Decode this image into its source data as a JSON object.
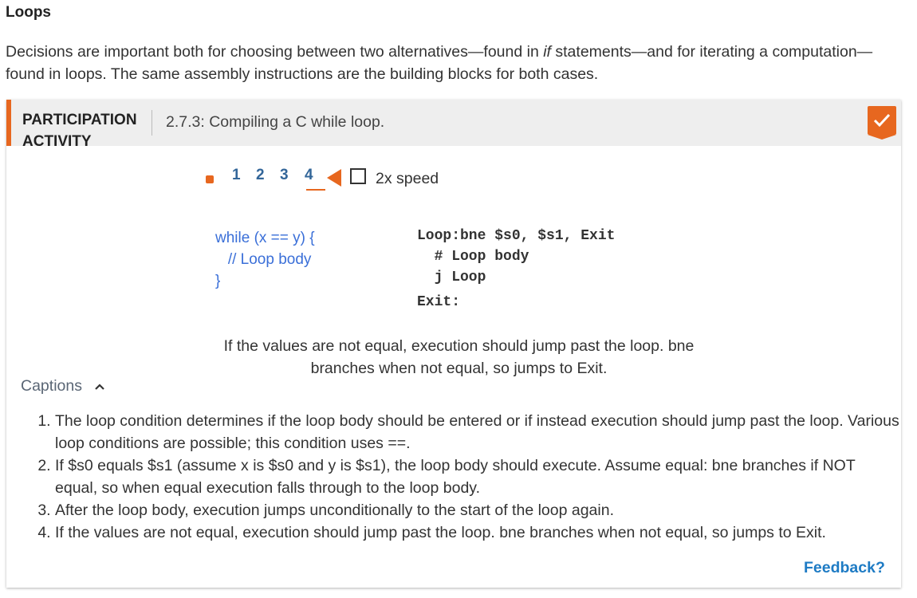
{
  "section": {
    "title": "Loops",
    "intro_before_if": "Decisions are important both for choosing between two alternatives—found in ",
    "intro_if": "if",
    "intro_after_if": " statements—and for iterating a computation—found in loops. The same assembly instructions are the building blocks for both cases."
  },
  "activity": {
    "kind_line1": "PARTICIPATION",
    "kind_line2": "ACTIVITY",
    "title": "2.7.3: Compiling a C while loop.",
    "completed": true,
    "accent_color": "#e7671f",
    "controls": {
      "steps": [
        "1",
        "2",
        "3",
        "4"
      ],
      "current_step": 4,
      "speed_label": "2x speed",
      "speed_checked": false
    },
    "c_code": [
      "while (x == y) {",
      "   // Loop body",
      "}"
    ],
    "asm_code": [
      "Loop:bne $s0, $s1, Exit",
      "  # Loop body",
      "  j Loop",
      "Exit:"
    ],
    "current_caption": "If the values are not equal, execution should jump past the loop. bne branches when not equal, so jumps to Exit.",
    "captions_toggle_label": "Captions",
    "captions": [
      "The loop condition determines if the loop body should be entered or if instead execution should jump past the loop. Various loop conditions are possible; this condition uses ==.",
      "If $s0 equals $s1 (assume x is $s0 and y is $s1), the loop body should execute. Assume equal: bne branches if NOT equal, so when equal execution falls through to the loop body.",
      "After the loop body, execution jumps unconditionally to the start of the loop again.",
      "If the values are not equal, execution should jump past the loop. bne branches when not equal, so jumps to Exit."
    ],
    "feedback_label": "Feedback?"
  }
}
